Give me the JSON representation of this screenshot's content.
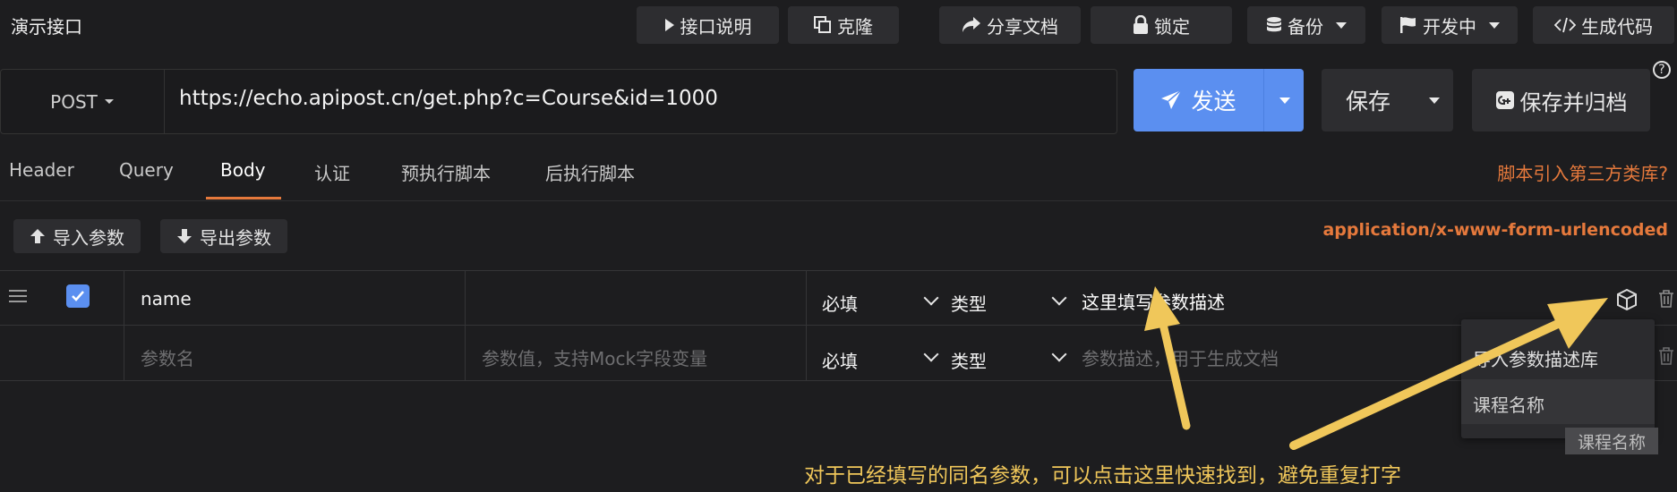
{
  "app_title": "演示接口",
  "toolbar": {
    "doc_label": "接口说明",
    "clone_label": "克隆",
    "share_label": "分享文档",
    "lock_label": "锁定",
    "backup_label": "备份",
    "status_label": "开发中",
    "codegen_label": "生成代码"
  },
  "request": {
    "method": "POST",
    "url": "https://echo.apipost.cn/get.php?c=Course&id=1000",
    "send_label": "发送",
    "save_label": "保存",
    "archive_label": "保存并归档"
  },
  "tabs": {
    "header": "Header",
    "query": "Query",
    "body": "Body",
    "auth": "认证",
    "pre_script": "预执行脚本",
    "post_script": "后执行脚本"
  },
  "script_link": "脚本引入第三方类库?",
  "params_toolbar": {
    "import_label": "导入参数",
    "export_label": "导出参数",
    "content_type": "application/x-www-form-urlencoded"
  },
  "params": {
    "row1": {
      "name": "name",
      "required": "必填",
      "type": "类型",
      "description": "这里填写参数描述"
    },
    "row2": {
      "name_placeholder": "参数名",
      "value_placeholder": "参数值，支持Mock字段变量",
      "required": "必填",
      "type": "类型",
      "description_placeholder": "参数描述，用于生成文档"
    }
  },
  "dropdown": {
    "header": "导入参数描述库",
    "item": "课程名称",
    "tooltip": "课程名称"
  },
  "annotation": "对于已经填写的同名参数，可以点击这里快速找到，避免重复打字",
  "colors": {
    "accent_blue": "#5b8ff0",
    "accent_orange": "#e5793c",
    "annotation_yellow": "#f0c75a"
  }
}
